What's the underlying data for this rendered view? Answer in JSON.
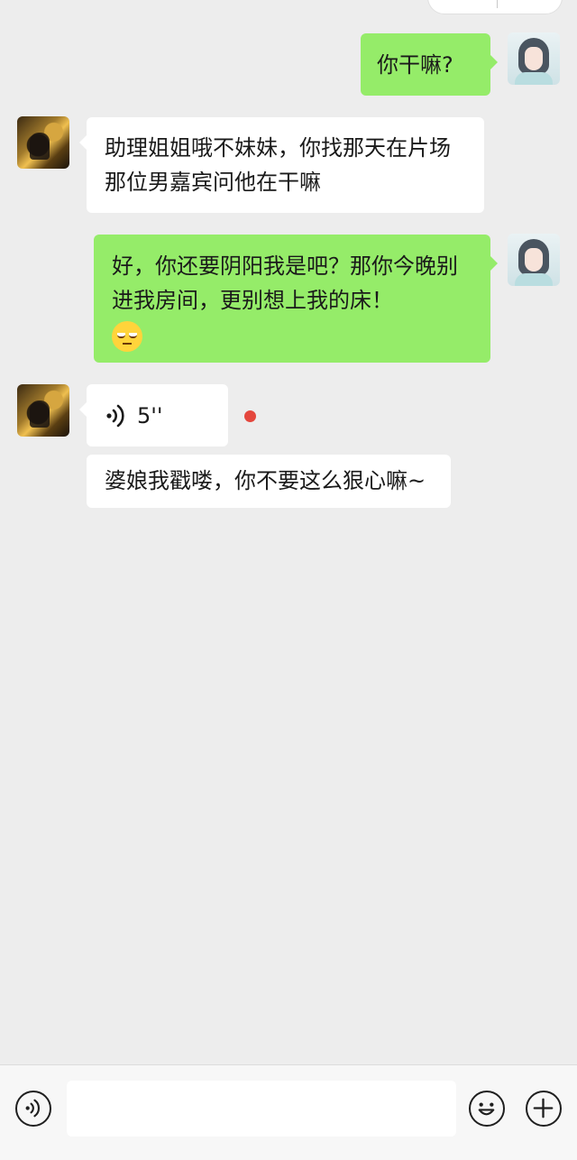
{
  "messages": [
    {
      "sender": "me",
      "type": "text",
      "text": "你干嘛?"
    },
    {
      "sender": "other",
      "type": "text",
      "text": "助理姐姐哦不妹妹，你找那天在片场那位男嘉宾问他在干嘛"
    },
    {
      "sender": "me",
      "type": "text",
      "text": "好，你还要阴阳我是吧？那你今晚别进我房间，更别想上我的床！",
      "emoji": "unamused-face"
    },
    {
      "sender": "other",
      "type": "voice",
      "duration": "5''",
      "unread": true
    },
    {
      "sender": "other",
      "type": "text",
      "text": "婆娘我戳喽，你不要这么狠心嘛~"
    }
  ],
  "input_bar": {
    "placeholder": "",
    "icons": [
      "voice-icon",
      "emoji-icon",
      "plus-icon"
    ]
  },
  "colors": {
    "background": "#ededed",
    "outgoing_bubble": "#95ec69",
    "incoming_bubble": "#ffffff",
    "unread_dot": "#e4473d"
  }
}
